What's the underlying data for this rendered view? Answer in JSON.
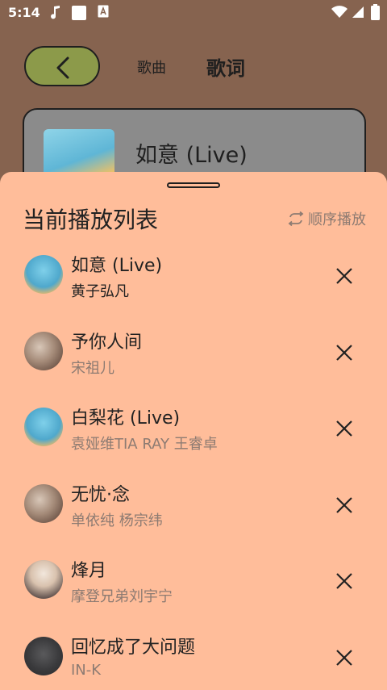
{
  "status_bar": {
    "time": "5:14",
    "icons": [
      "music-note-icon",
      "square-icon",
      "keyboard-a-icon",
      "wifi-icon",
      "signal-icon",
      "battery-icon"
    ]
  },
  "header": {
    "back_icon": "chevron-left-icon",
    "tab_song": "歌曲",
    "tab_lyrics": "歌词"
  },
  "now_playing": {
    "title": "如意 (Live)"
  },
  "playlist_sheet": {
    "title": "当前播放列表",
    "play_mode_label": "顺序播放",
    "play_mode_icon": "repeat-icon",
    "items": [
      {
        "title": "如意 (Live)",
        "artist": "黄子弘凡",
        "active": true,
        "cover": "cov-a"
      },
      {
        "title": "予你人间",
        "artist": "宋祖儿",
        "active": false,
        "cover": "cov-b"
      },
      {
        "title": "白梨花 (Live)",
        "artist": "袁娅维TIA RAY 王睿卓",
        "active": false,
        "cover": "cov-a"
      },
      {
        "title": "无忧·念",
        "artist": "单依纯 杨宗纬",
        "active": false,
        "cover": "cov-b"
      },
      {
        "title": "烽月",
        "artist": "摩登兄弟刘宇宁",
        "active": false,
        "cover": "cov-c"
      },
      {
        "title": "回忆成了大问题",
        "artist": "IN-K",
        "active": false,
        "cover": "cov-d"
      }
    ]
  },
  "colors": {
    "background": "#86634f",
    "sheet": "#ffbd9a",
    "back_button": "#8c9a4a",
    "secondary_text": "#8d7b72"
  }
}
